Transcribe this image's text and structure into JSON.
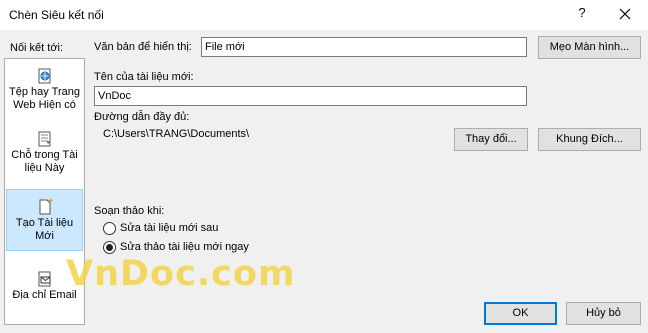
{
  "dialog": {
    "title": "Chèn Siêu kết nối",
    "help_glyph": "?",
    "close_icon": "close-icon"
  },
  "nav": {
    "label": "Nối kết tới:",
    "items": [
      {
        "label": "Tệp hay Trang Web Hiện có",
        "icon": "web-page-icon"
      },
      {
        "label": "Chỗ trong Tài liệu Này",
        "icon": "bookmark-place-icon"
      },
      {
        "label": "Tạo Tài liệu Mới",
        "icon": "new-document-icon",
        "selected": true
      },
      {
        "label": "Địa chỉ Email",
        "icon": "email-icon"
      }
    ]
  },
  "form": {
    "display_text_label": "Văn bản để hiển thị:",
    "display_text_value": "File mới",
    "screentip_button": "Mẹo Màn hình...",
    "new_doc_name_label": "Tên của tài liệu mới:",
    "new_doc_name_value": "VnDoc",
    "full_path_label": "Đường dẫn đầy đủ:",
    "full_path_value": "C:\\Users\\TRANG\\Documents\\",
    "change_button": "Thay đổi...",
    "target_frame_button": "Khung Đích...",
    "when_to_edit_label": "Soạn thảo khi:",
    "edit_options": [
      {
        "label": "Sửa tài liệu mới sau",
        "checked": false
      },
      {
        "label": "Sửa thảo tài liệu mới ngay",
        "checked": true
      }
    ]
  },
  "watermark": "VnDoc.com",
  "footer": {
    "ok_button": "OK",
    "cancel_button": "Hủy bỏ"
  }
}
